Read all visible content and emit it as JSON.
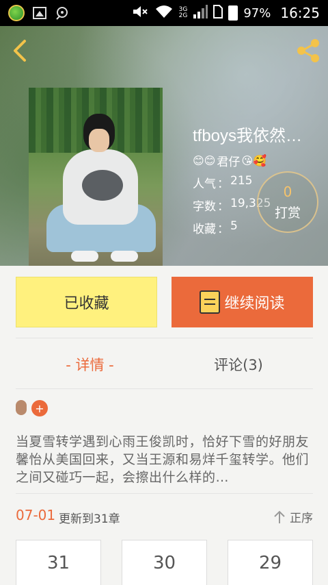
{
  "status_bar": {
    "signal_top": "3G",
    "signal_bottom": "2G",
    "battery": "97%",
    "time": "16:25"
  },
  "book": {
    "title": "tfboys我依然…",
    "author": "君仔",
    "stats": {
      "popularity_label": "人气",
      "popularity": "215",
      "words_label": "字数",
      "words": "19,325",
      "favorites_label": "收藏",
      "favorites": "5"
    },
    "tip": {
      "count": "0",
      "label": "打赏"
    }
  },
  "actions": {
    "favorited_label": "已收藏",
    "continue_label": "继续阅读"
  },
  "tabs": {
    "detail": "- 详情 -",
    "comments": "评论(3)"
  },
  "tags": {
    "add": "+"
  },
  "summary": "当夏雪转学遇到心雨王俊凯时，恰好下雪的好朋友馨怡从美国回来，又当王源和易烊千玺转学。他们之间又碰巧一起，会擦出什么样的…",
  "update": {
    "date": "07-01",
    "text": "更新到31章",
    "sort_label": "正序"
  },
  "chapters": [
    "31",
    "30",
    "29"
  ]
}
